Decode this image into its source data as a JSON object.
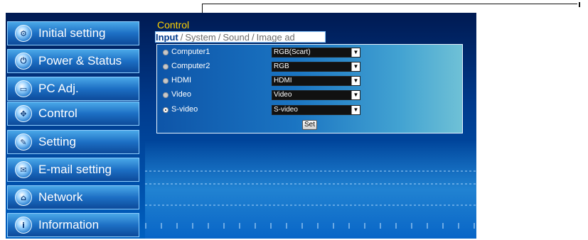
{
  "sidebar": {
    "items": [
      {
        "label": "Initial setting",
        "icon": "settings-icon"
      },
      {
        "label": "Power & Status",
        "icon": "power-icon"
      },
      {
        "label": "PC Adj.",
        "icon": "monitor-icon"
      },
      {
        "label": "Control",
        "icon": "control-icon"
      },
      {
        "label": "Setting",
        "icon": "wrench-icon"
      },
      {
        "label": "E-mail setting",
        "icon": "mail-icon"
      },
      {
        "label": "Network",
        "icon": "network-icon"
      },
      {
        "label": "Information",
        "icon": "info-icon"
      }
    ]
  },
  "content": {
    "section_title": "Control",
    "tabs": {
      "active": "Input",
      "others": [
        "System",
        "Sound",
        "Image ad"
      ],
      "separator": "/"
    },
    "inputs": [
      {
        "label": "Computer1",
        "selected": false,
        "value": "RGB(Scart)"
      },
      {
        "label": "Computer2",
        "selected": false,
        "value": "RGB"
      },
      {
        "label": "HDMI",
        "selected": false,
        "value": "HDMI"
      },
      {
        "label": "Video",
        "selected": false,
        "value": "Video"
      },
      {
        "label": "S-video",
        "selected": true,
        "value": "S-video"
      }
    ],
    "set_label": "Set"
  },
  "colors": {
    "section_title": "#ffd200",
    "frame_dark": "#001a52",
    "frame_light": "#0060c0",
    "active_tab": "#003a8c"
  }
}
